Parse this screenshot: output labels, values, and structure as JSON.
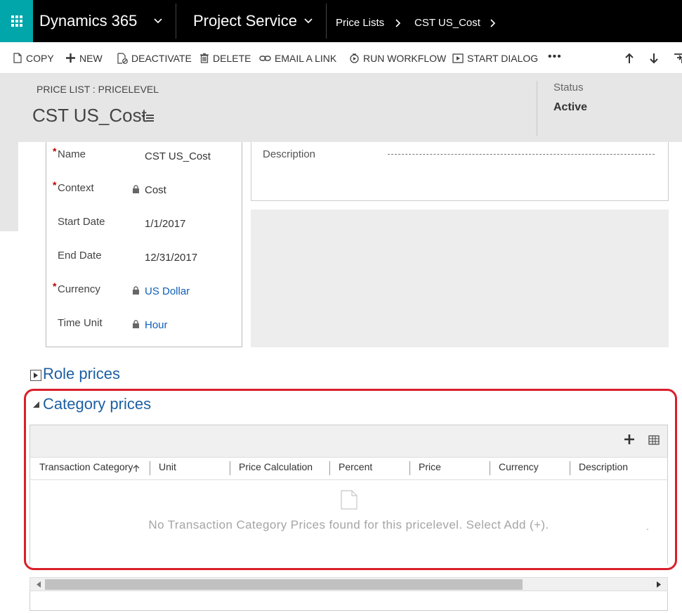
{
  "topnav": {
    "app_name": "Dynamics 365",
    "module_name": "Project Service",
    "breadcrumbs": [
      "Price Lists",
      "CST US_Cost"
    ],
    "waffle_color": "#00a6a9"
  },
  "commands": {
    "copy": "COPY",
    "new": "NEW",
    "deactivate": "DEACTIVATE",
    "delete": "DELETE",
    "email_link": "EMAIL A LINK",
    "run_workflow": "RUN WORKFLOW",
    "start_dialog": "START DIALOG",
    "more": "•••"
  },
  "header": {
    "entity_type": "PRICE LIST : PRICELEVEL",
    "title": "CST US_Cost",
    "status_label": "Status",
    "status_value": "Active"
  },
  "fields": {
    "name": {
      "label": "Name",
      "value": "CST US_Cost"
    },
    "context": {
      "label": "Context",
      "value": "Cost"
    },
    "start_date": {
      "label": "Start Date",
      "value": "1/1/2017"
    },
    "end_date": {
      "label": "End Date",
      "value": "12/31/2017"
    },
    "currency": {
      "label": "Currency",
      "value": "US Dollar"
    },
    "time_unit": {
      "label": "Time Unit",
      "value": "Hour"
    },
    "description": {
      "label": "Description"
    },
    "required_marker": "*"
  },
  "role_prices": {
    "title": "Role prices"
  },
  "category_prices": {
    "title": "Category prices",
    "columns": [
      "Transaction Category",
      "Unit",
      "Price Calculation",
      "Percent",
      "Price",
      "Currency",
      "Description"
    ],
    "empty_message": "No Transaction Category Prices found for this pricelevel. Select Add (+).",
    "highlight_color": "#d91f2a"
  },
  "colors": {
    "link": "#1160b7",
    "section_title": "#1d5fa3",
    "header_bg": "#e6e6e6"
  }
}
